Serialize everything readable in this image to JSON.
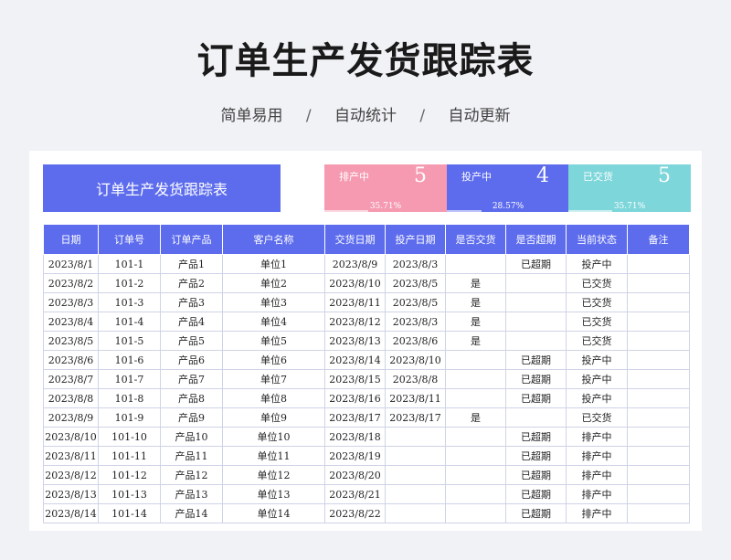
{
  "title": "订单生产发货跟踪表",
  "subtitle": {
    "items": [
      "简单易用",
      "自动统计",
      "自动更新"
    ],
    "separator": "/"
  },
  "banner": "订单生产发货跟踪表",
  "stats": [
    {
      "label": "排产中",
      "value": "5",
      "percent": "35.71%",
      "fraction": 0.3571,
      "color": "#f59ab0"
    },
    {
      "label": "投产中",
      "value": "4",
      "percent": "28.57%",
      "fraction": 0.2857,
      "color": "#5d6ced"
    },
    {
      "label": "已交货",
      "value": "5",
      "percent": "35.71%",
      "fraction": 0.3571,
      "color": "#7dd6da"
    }
  ],
  "table": {
    "headers": [
      "日期",
      "订单号",
      "订单产品",
      "客户名称",
      "交货日期",
      "投产日期",
      "是否交货",
      "是否超期",
      "当前状态",
      "备注"
    ],
    "rows": [
      [
        "2023/8/1",
        "101-1",
        "产品1",
        "单位1",
        "2023/8/9",
        "2023/8/3",
        "",
        "已超期",
        "投产中",
        ""
      ],
      [
        "2023/8/2",
        "101-2",
        "产品2",
        "单位2",
        "2023/8/10",
        "2023/8/5",
        "是",
        "",
        "已交货",
        ""
      ],
      [
        "2023/8/3",
        "101-3",
        "产品3",
        "单位3",
        "2023/8/11",
        "2023/8/5",
        "是",
        "",
        "已交货",
        ""
      ],
      [
        "2023/8/4",
        "101-4",
        "产品4",
        "单位4",
        "2023/8/12",
        "2023/8/3",
        "是",
        "",
        "已交货",
        ""
      ],
      [
        "2023/8/5",
        "101-5",
        "产品5",
        "单位5",
        "2023/8/13",
        "2023/8/6",
        "是",
        "",
        "已交货",
        ""
      ],
      [
        "2023/8/6",
        "101-6",
        "产品6",
        "单位6",
        "2023/8/14",
        "2023/8/10",
        "",
        "已超期",
        "投产中",
        ""
      ],
      [
        "2023/8/7",
        "101-7",
        "产品7",
        "单位7",
        "2023/8/15",
        "2023/8/8",
        "",
        "已超期",
        "投产中",
        ""
      ],
      [
        "2023/8/8",
        "101-8",
        "产品8",
        "单位8",
        "2023/8/16",
        "2023/8/11",
        "",
        "已超期",
        "投产中",
        ""
      ],
      [
        "2023/8/9",
        "101-9",
        "产品9",
        "单位9",
        "2023/8/17",
        "2023/8/17",
        "是",
        "",
        "已交货",
        ""
      ],
      [
        "2023/8/10",
        "101-10",
        "产品10",
        "单位10",
        "2023/8/18",
        "",
        "",
        "已超期",
        "排产中",
        ""
      ],
      [
        "2023/8/11",
        "101-11",
        "产品11",
        "单位11",
        "2023/8/19",
        "",
        "",
        "已超期",
        "排产中",
        ""
      ],
      [
        "2023/8/12",
        "101-12",
        "产品12",
        "单位12",
        "2023/8/20",
        "",
        "",
        "已超期",
        "排产中",
        ""
      ],
      [
        "2023/8/13",
        "101-13",
        "产品13",
        "单位13",
        "2023/8/21",
        "",
        "",
        "已超期",
        "排产中",
        ""
      ],
      [
        "2023/8/14",
        "101-14",
        "产品14",
        "单位14",
        "2023/8/22",
        "",
        "",
        "已超期",
        "排产中",
        ""
      ]
    ]
  }
}
